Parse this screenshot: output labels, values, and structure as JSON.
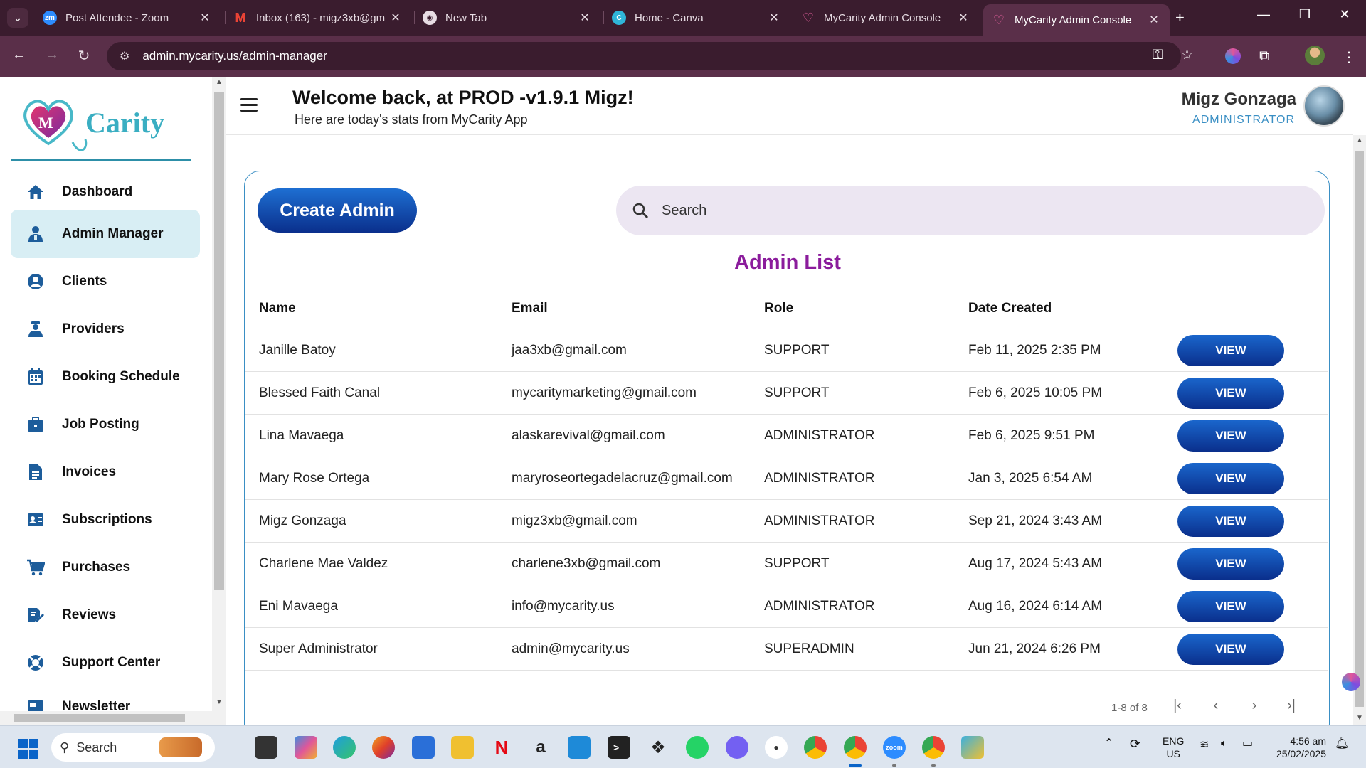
{
  "browser": {
    "tabs": [
      {
        "title": "Post Attendee - Zoom",
        "icon": "zoom-icon"
      },
      {
        "title": "Inbox (163) - migz3xb@gm",
        "icon": "gmail-icon"
      },
      {
        "title": "New Tab",
        "icon": "chrome-icon"
      },
      {
        "title": "Home - Canva",
        "icon": "canva-icon"
      },
      {
        "title": "MyCarity Admin Console",
        "icon": "heart-icon"
      },
      {
        "title": "MyCarity Admin Console",
        "icon": "heart-icon"
      }
    ],
    "active_tab": 5,
    "url": "admin.mycarity.us/admin-manager"
  },
  "sidebar": {
    "logo_text": "MyCarity",
    "items": [
      {
        "label": "Dashboard",
        "icon": "home-icon"
      },
      {
        "label": "Admin Manager",
        "icon": "admin-user-icon",
        "active": true
      },
      {
        "label": "Clients",
        "icon": "client-circle-icon"
      },
      {
        "label": "Providers",
        "icon": "provider-icon"
      },
      {
        "label": "Booking Schedule",
        "icon": "calendar-icon"
      },
      {
        "label": "Job Posting",
        "icon": "briefcase-icon"
      },
      {
        "label": "Invoices",
        "icon": "document-icon"
      },
      {
        "label": "Subscriptions",
        "icon": "id-card-icon"
      },
      {
        "label": "Purchases",
        "icon": "cart-icon"
      },
      {
        "label": "Reviews",
        "icon": "review-icon"
      },
      {
        "label": "Support Center",
        "icon": "lifebuoy-icon"
      },
      {
        "label": "Newsletter",
        "icon": "newsletter-icon"
      }
    ]
  },
  "header": {
    "welcome": "Welcome back, at PROD -v1.9.1 Migz!",
    "subtitle": "Here are today's stats from MyCarity App",
    "user_name": "Migz Gonzaga",
    "user_role": "ADMINISTRATOR"
  },
  "admin": {
    "create_label": "Create Admin",
    "search_placeholder": "Search",
    "list_title": "Admin List",
    "columns": {
      "name": "Name",
      "email": "Email",
      "role": "Role",
      "date": "Date Created"
    },
    "view_label": "VIEW",
    "rows": [
      {
        "name": "Janille Batoy",
        "email": "jaa3xb@gmail.com",
        "role": "SUPPORT",
        "date": "Feb 11, 2025 2:35 PM"
      },
      {
        "name": "Blessed Faith Canal",
        "email": "mycaritymarketing@gmail.com",
        "role": "SUPPORT",
        "date": "Feb 6, 2025 10:05 PM"
      },
      {
        "name": "Lina Mavaega",
        "email": "alaskarevival@gmail.com",
        "role": "ADMINISTRATOR",
        "date": "Feb 6, 2025 9:51 PM"
      },
      {
        "name": "Mary Rose Ortega",
        "email": "maryroseortegadelacruz@gmail.com",
        "role": "ADMINISTRATOR",
        "date": "Jan 3, 2025 6:54 AM"
      },
      {
        "name": "Migz Gonzaga",
        "email": "migz3xb@gmail.com",
        "role": "ADMINISTRATOR",
        "date": "Sep 21, 2024 3:43 AM"
      },
      {
        "name": "Charlene Mae Valdez",
        "email": "charlene3xb@gmail.com",
        "role": "SUPPORT",
        "date": "Aug 17, 2024 5:43 AM"
      },
      {
        "name": "Eni Mavaega",
        "email": "info@mycarity.us",
        "role": "ADMINISTRATOR",
        "date": "Aug 16, 2024 6:14 AM"
      },
      {
        "name": "Super Administrator",
        "email": "admin@mycarity.us",
        "role": "SUPERADMIN",
        "date": "Jun 21, 2024 6:26 PM"
      }
    ],
    "pagination": "1-8 of 8"
  },
  "taskbar": {
    "search_label": "Search",
    "language": "ENG",
    "region": "US",
    "time": "4:56 am",
    "date": "25/02/2025"
  },
  "colors": {
    "accent": "#0a2f8c",
    "title_purple": "#8b1c9c",
    "role_blue": "#3a8fc4",
    "active_nav": "#d8eef4"
  }
}
